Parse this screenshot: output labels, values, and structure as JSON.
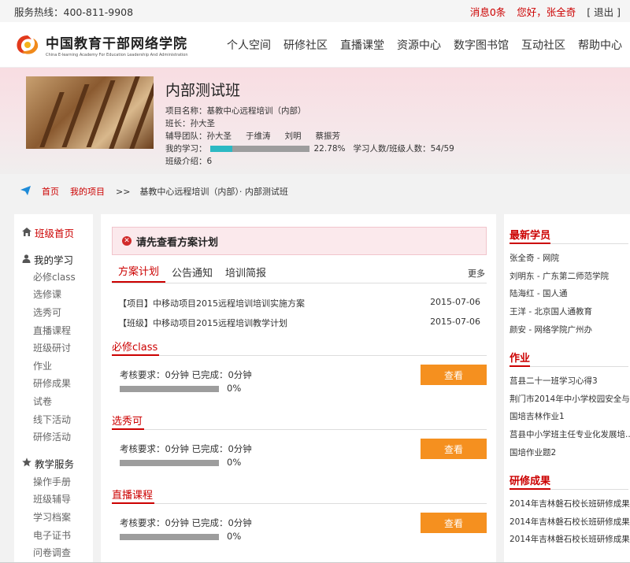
{
  "topbar": {
    "hotline": "服务热线：400-811-9908",
    "messages": "消息0条",
    "greeting": "您好，张全奇",
    "logout": "[ 退出 ]"
  },
  "header": {
    "logo_cn": "中国教育干部网络学院",
    "logo_en": "China E-learning Academy For Education Leadership And Administration",
    "nav": [
      "个人空间",
      "研修社区",
      "直播课堂",
      "资源中心",
      "数字图书馆",
      "互动社区",
      "帮助中心"
    ]
  },
  "banner": {
    "title": "内部测试班",
    "project": "项目名称：基教中心远程培训（内部）",
    "monitor": "班长：孙大圣",
    "team_label": "辅导团队：",
    "team": [
      "孙大圣",
      "于维涛",
      "刘明",
      "蔡振芳"
    ],
    "my_study_label": "我的学习：",
    "progress_fraction": 0.2278,
    "progress_text": "22.78%",
    "study_count": "学习人数/班级人数：54/59",
    "intro": "班级介绍：6"
  },
  "breadcrumb": {
    "home": "首页",
    "my_projects": "我的项目",
    "sep": ">>",
    "current": "基教中心远程培训（内部）· 内部测试班"
  },
  "sidebar": {
    "home": "班级首页",
    "my_study": "我的学习",
    "study_items": [
      "必修class",
      "选修课",
      "选秀可",
      "直播课程",
      "班级研讨",
      "作业",
      "研修成果",
      "试卷",
      "线下活动",
      "研修活动"
    ],
    "teaching": "教学服务",
    "teaching_items": [
      "操作手册",
      "班级辅导",
      "学习档案",
      "电子证书",
      "问卷调查"
    ]
  },
  "main": {
    "alert": "请先查看方案计划",
    "tabs": [
      "方案计划",
      "公告通知",
      "培训简报"
    ],
    "more": "更多",
    "notices": [
      {
        "title": "【项目】中移动项目2015远程培训培训实施方案",
        "date": "2015-07-06"
      },
      {
        "title": "【班级】中移动项目2015远程培训教学计划",
        "date": "2015-07-06"
      }
    ],
    "sections": [
      {
        "title": "必修class",
        "requirement": "考核要求：0分钟 已完成：0分钟",
        "percent": "0%",
        "button": "查看"
      },
      {
        "title": "选秀可",
        "requirement": "考核要求：0分钟 已完成：0分钟",
        "percent": "0%",
        "button": "查看"
      },
      {
        "title": "直播课程",
        "requirement": "考核要求：0分钟 已完成：0分钟",
        "percent": "0%",
        "button": "查看"
      }
    ]
  },
  "right": {
    "students_title": "最新学员",
    "students": [
      "张全奇 - 网院",
      "刘明东 - 广东第二师范学院",
      "陆海红 - 国人通",
      "王洋 - 北京国人通教育",
      "颜安 - 网络学院广州办"
    ],
    "homework_title": "作业",
    "homework": [
      "莒县二十一班学习心得3",
      "荆门市2014年中小学校园安全与...",
      "国培吉林作业1",
      "莒县中小学班主任专业化发展培...",
      "国培作业题2"
    ],
    "results_title": "研修成果",
    "results": [
      "2014年吉林磐石校长班研修成果",
      "2014年吉林磐石校长班研修成果",
      "2014年吉林磐石校长班研修成果"
    ]
  },
  "colors": {
    "accent_red": "#cc0000",
    "progress_teal": "#2cb9c3",
    "button_orange": "#f5901f"
  }
}
